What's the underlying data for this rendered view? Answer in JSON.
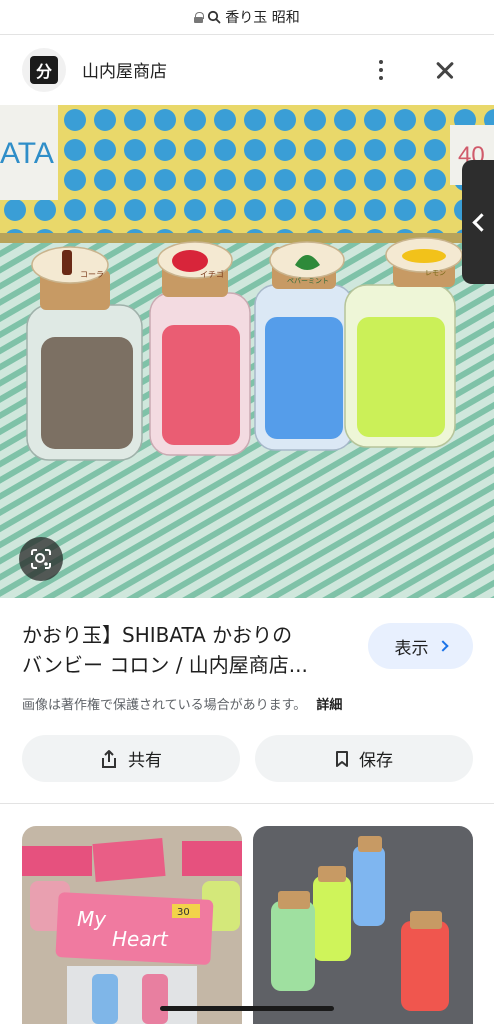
{
  "browser": {
    "url_text": "香り玉 昭和"
  },
  "header": {
    "favicon_glyph": "分",
    "site_name": "山内屋商店"
  },
  "main_image": {
    "box_text_left": "ATA",
    "box_text_right": "40",
    "labels": [
      "コーラ",
      "イチゴ",
      "ペパーミント",
      "レモン"
    ],
    "jar_colors": [
      "#6b5a4c",
      "#e8465f",
      "#3d8fe8",
      "#c6f04a"
    ]
  },
  "result": {
    "title_line1": "かおり玉】SHIBATA かおりの",
    "title_line2": "バンビー コロン / 山内屋商店...",
    "visit_label": "表示",
    "copyright_text": "画像は著作権で保護されている場合があります。",
    "detail_label": "詳細"
  },
  "actions": {
    "share_label": "共有",
    "save_label": "保存"
  },
  "related": {
    "thumb1_text_1": "My",
    "thumb1_text_2": "Heart",
    "thumb1_price": "30"
  }
}
